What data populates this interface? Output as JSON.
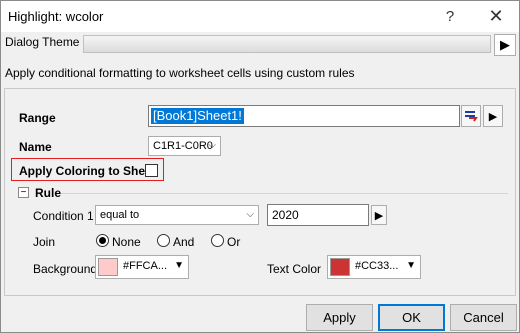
{
  "window": {
    "title": "Highlight: wcolor",
    "help_glyph": "?",
    "close_glyph": "✕"
  },
  "theme": {
    "label": "Dialog Theme",
    "arrow_glyph": "▶"
  },
  "description": "Apply conditional formatting to worksheet cells using custom rules",
  "range": {
    "label": "Range",
    "value": "[Book1]Sheet1!",
    "picker_icon": "range-picker-icon",
    "arrow_glyph": "▶"
  },
  "name": {
    "label": "Name",
    "value": "C1R1-C0R0",
    "chevron": "⌵"
  },
  "apply_coloring": {
    "label": "Apply Coloring to Sheet",
    "checked": false
  },
  "rule": {
    "label": "Rule",
    "toggle_glyph": "−",
    "condition": {
      "label": "Condition 1",
      "operator": "equal to",
      "chevron": "⌵",
      "value": "2020",
      "arrow_glyph": "▶"
    },
    "join": {
      "label": "Join",
      "options": [
        "None",
        "And",
        "Or"
      ],
      "selected": "None"
    },
    "background": {
      "label": "Background",
      "value": "#FFCA...",
      "color": "#FFCACA",
      "arrow_glyph": "▼"
    },
    "text_color": {
      "label": "Text Color",
      "value": "#CC33...",
      "color": "#CC3333",
      "arrow_glyph": "▼"
    }
  },
  "buttons": {
    "apply": "Apply",
    "ok": "OK",
    "cancel": "Cancel"
  }
}
